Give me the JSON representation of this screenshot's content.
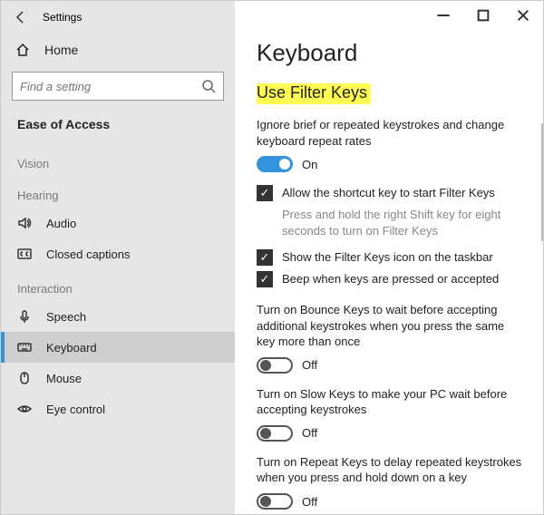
{
  "titlebar": {
    "app_title": "Settings"
  },
  "sidebar": {
    "home": "Home",
    "search_placeholder": "Find a setting",
    "section": "Ease of Access",
    "groups": {
      "vision": "Vision",
      "hearing": "Hearing",
      "interaction": "Interaction"
    },
    "items": {
      "audio": "Audio",
      "closed_captions": "Closed captions",
      "speech": "Speech",
      "keyboard": "Keyboard",
      "mouse": "Mouse",
      "eye_control": "Eye control"
    }
  },
  "main": {
    "page_title": "Keyboard",
    "section_h": "Use Filter Keys",
    "filter_desc": "Ignore brief or repeated keystrokes and change keyboard repeat rates",
    "on": "On",
    "off": "Off",
    "allow_shortcut": "Allow the shortcut key to start Filter Keys",
    "shortcut_hint": "Press and hold the right Shift key for eight seconds to turn on Filter Keys",
    "show_icon": "Show the Filter Keys icon on the taskbar",
    "beep": "Beep when keys are pressed or accepted",
    "bounce_desc": "Turn on Bounce Keys to wait before accepting additional keystrokes when you press the same key more than once",
    "slow_desc": "Turn on Slow Keys to make your PC wait before accepting keystrokes",
    "repeat_desc": "Turn on Repeat Keys to delay repeated keystrokes when you press and hold down on a key"
  }
}
